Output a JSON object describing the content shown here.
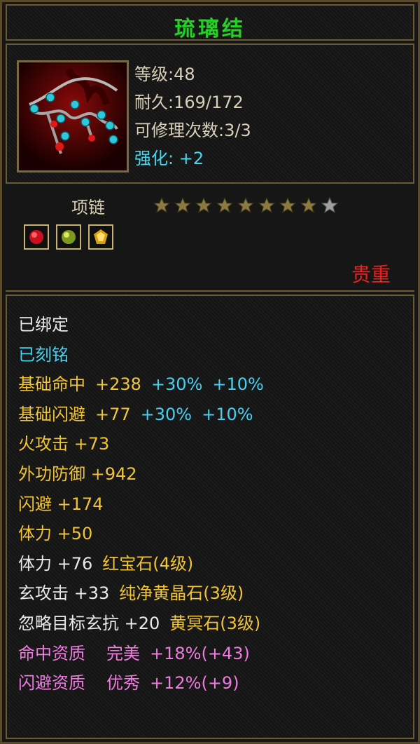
{
  "item": {
    "name": "琉璃结",
    "level": "等级:48",
    "durability": "耐久:169/172",
    "repair": "可修理次数:3/3",
    "enhance_label": "强化:",
    "enhance_value": "+2",
    "type": "项链",
    "stars_total": 9,
    "stars_filled": 8,
    "rarity": "贵重",
    "icon": "necklace-chain-icon",
    "gems": [
      "ruby-gem-icon",
      "green-gem-icon",
      "gold-gem-icon"
    ]
  },
  "attributes": {
    "bound": "已绑定",
    "engraved": "已刻铭",
    "hit": {
      "name": "基础命中",
      "value": "+238",
      "pct1": "+30%",
      "pct2": "+10%"
    },
    "dodge": {
      "name": "基础闪避",
      "value": "+77",
      "pct1": "+30%",
      "pct2": "+10%"
    },
    "fire_attack": "火攻击 +73",
    "outer_defense": "外功防御 +942",
    "evade": "闪避 +174",
    "stamina": "体力 +50",
    "gem1": {
      "stat": "体力 +76",
      "gem": "红宝石(4级)"
    },
    "gem2": {
      "stat": "玄攻击 +33",
      "gem": "纯净黄晶石(3级)"
    },
    "gem3": {
      "stat": "忽略目标玄抗 +20",
      "gem": "黄冥石(3级)"
    },
    "apt1": {
      "name": "命中资质",
      "grade": "完美",
      "value": "+18%(+43)"
    },
    "apt2": {
      "name": "闪避资质",
      "grade": "优秀",
      "value": "+12%(+9)"
    }
  },
  "colors": {
    "title": "#25d025",
    "cyan": "#46d0f2",
    "gold": "#f0c434",
    "pink": "#f07ae0",
    "red": "#e82222"
  }
}
